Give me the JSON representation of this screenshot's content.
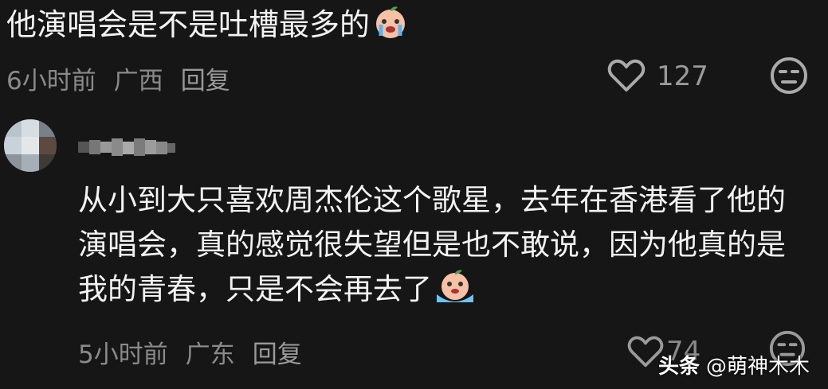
{
  "comment": {
    "text": "他演唱会是不是吐槽最多的",
    "emoji_icon": "crying-face-icon",
    "time": "6小时前",
    "location": "广西",
    "reply_label": "回复",
    "like_icon": "heart-icon",
    "like_count": "127",
    "reaction_icon": "neutral-face-icon"
  },
  "reply": {
    "avatar_icon": "blurred-avatar",
    "username_icon": "blurred-username",
    "text": "从小到大只喜欢周杰伦这个歌星，去年在香港看了他的演唱会，真的感觉很失望但是也不敢说，因为他真的是我的青春，只是不会再去了",
    "emoji_icon": "crying-face-icon",
    "time": "5小时前",
    "location": "广东",
    "reply_label": "回复",
    "like_icon": "heart-icon",
    "like_count": "74",
    "reaction_icon": "neutral-face-icon"
  },
  "watermark": {
    "brand": "头条",
    "handle": "@萌神木木"
  }
}
